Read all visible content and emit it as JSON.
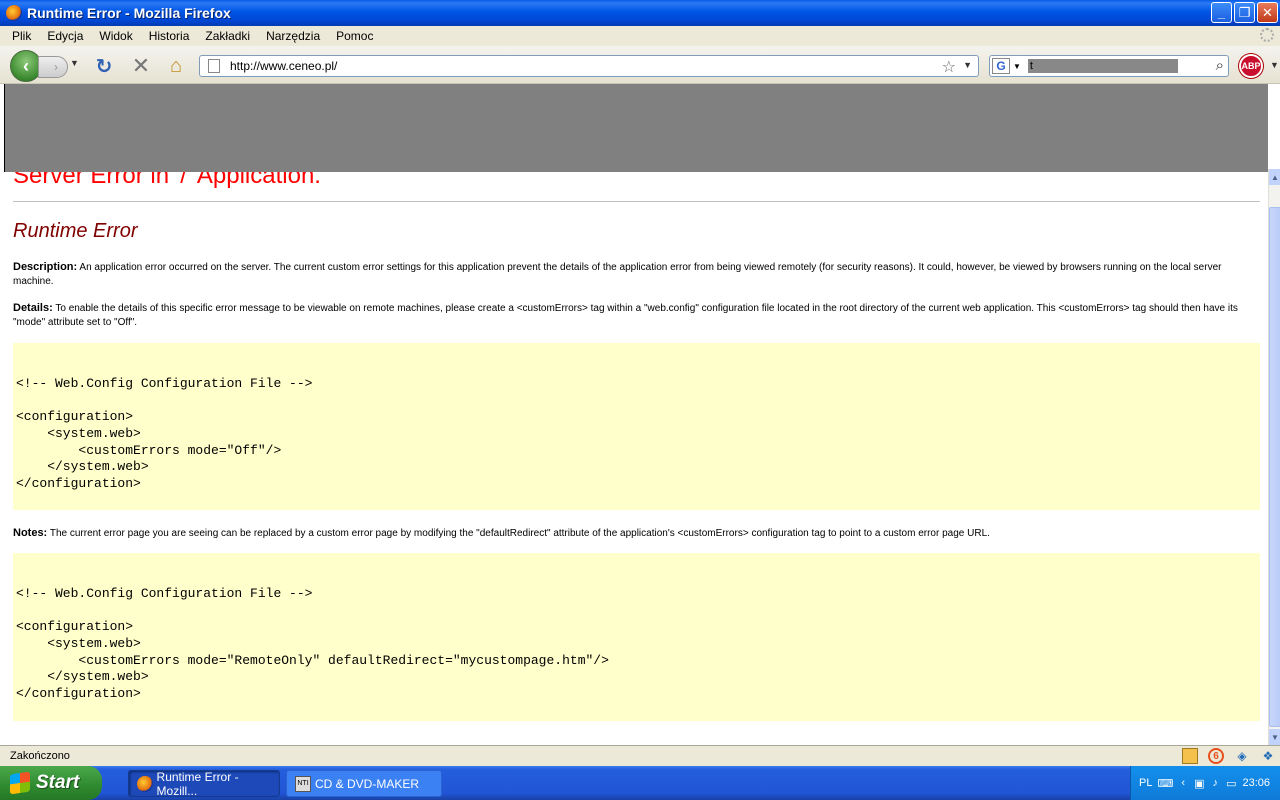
{
  "window": {
    "title": "Runtime Error - Mozilla Firefox",
    "minimize": "_",
    "maximize": "❐",
    "close": "✕"
  },
  "menu": [
    "Plik",
    "Edycja",
    "Widok",
    "Historia",
    "Zakładki",
    "Narzędzia",
    "Pomoc"
  ],
  "nav": {
    "url": "http://www.ceneo.pl/",
    "search_value": "t",
    "engine": "G"
  },
  "page": {
    "heading": "Server Error in '/' Application.",
    "subheading": "Runtime Error",
    "description_label": "Description:",
    "description_text": " An application error occurred on the server. The current custom error settings for this application prevent the details of the application error from being viewed remotely (for security reasons). It could, however, be viewed by browsers running on the local server machine.",
    "details_label": "Details:",
    "details_text": " To enable the details of this specific error message to be viewable on remote machines, please create a <customErrors> tag within a \"web.config\" configuration file located in the root directory of the current web application. This <customErrors> tag should then have its \"mode\" attribute set to \"Off\".",
    "code1": "\n<!-- Web.Config Configuration File -->\n\n<configuration>\n    <system.web>\n        <customErrors mode=\"Off\"/>\n    </system.web>\n</configuration>",
    "notes_label": "Notes:",
    "notes_text": " The current error page you are seeing can be replaced by a custom error page by modifying the \"defaultRedirect\" attribute of the application's <customErrors> configuration tag to point to a custom error page URL.",
    "code2": "\n<!-- Web.Config Configuration File -->\n\n<configuration>\n    <system.web>\n        <customErrors mode=\"RemoteOnly\" defaultRedirect=\"mycustompage.htm\"/>\n    </system.web>\n</configuration>"
  },
  "status": {
    "text": "Zakończono"
  },
  "taskbar": {
    "start": "Start",
    "tasks": [
      "Runtime Error - Mozill...",
      "CD & DVD-MAKER"
    ],
    "lang": "PL",
    "clock": "23:06"
  }
}
